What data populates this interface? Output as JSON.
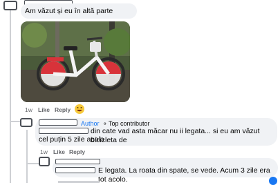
{
  "comment1": {
    "text": "Am văzut și eu în altă parte",
    "actions": {
      "time": "1w",
      "like": "Like",
      "reply": "Reply"
    },
    "reaction_icon": "laughing-face-emoji"
  },
  "reply1": {
    "author_badge": "Author",
    "contributor_badge": "Top contributor",
    "text_line1": "din cate vad asta măcar nu ii legata... si eu am văzut bicicleta de",
    "text_line2": "cel puțin 5 zile acolo",
    "actions": {
      "time": "1w",
      "like": "Like",
      "reply": "Reply"
    }
  },
  "reply2": {
    "text": "E legata. La roata din spate, se vede. Acum 3 zile era tot acolo."
  },
  "colors": {
    "bubble": "#f0f2f5",
    "thread_line": "#ced0d4",
    "author_blue": "#1877f2",
    "bike_red": "#d8333a"
  }
}
